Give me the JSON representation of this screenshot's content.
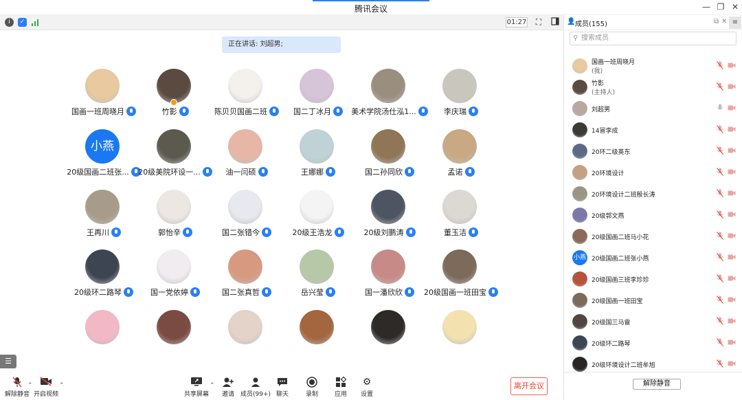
{
  "window": {
    "title": "腾讯会议"
  },
  "topbar": {
    "timer": "01:27"
  },
  "main": {
    "speaking_label": "正在讲话: ",
    "speaking_name": "刘超男;",
    "participants": [
      {
        "name": "国画一班周晓月",
        "avatar": "photo",
        "color": "#e8c9a0"
      },
      {
        "name": "竹影",
        "avatar": "photo",
        "color": "#5b4a3f",
        "host": true
      },
      {
        "name": "陈贝贝国画二班",
        "avatar": "photo",
        "color": "#f4f0ec"
      },
      {
        "name": "国二丁冰月",
        "avatar": "photo",
        "color": "#d6c4d8"
      },
      {
        "name": "美术学院汤仕泓1...",
        "avatar": "photo",
        "color": "#9a8f7f"
      },
      {
        "name": "李庆瑞",
        "avatar": "photo",
        "color": "#c9c7bd"
      },
      {
        "name": "20级国画二班张...",
        "avatar": "text",
        "text": "小燕",
        "color": "#1a78f2"
      },
      {
        "name": "20级美院环设一...",
        "avatar": "photo",
        "color": "#5c5a4f"
      },
      {
        "name": "油一闫硕",
        "avatar": "photo",
        "color": "#e6b7a6"
      },
      {
        "name": "王娜娜",
        "avatar": "photo",
        "color": "#bfd3d6"
      },
      {
        "name": "国二孙同欣",
        "avatar": "photo",
        "color": "#8f7657"
      },
      {
        "name": "孟诺",
        "avatar": "photo",
        "color": "#c9a983"
      },
      {
        "name": "王再川",
        "avatar": "photo",
        "color": "#a79c89"
      },
      {
        "name": "郭怡辛",
        "avatar": "photo",
        "color": "#ece7e2"
      },
      {
        "name": "国二张错今",
        "avatar": "photo",
        "color": "#e7e9ef"
      },
      {
        "name": "20级王浩龙",
        "avatar": "photo",
        "color": "#f4f4f4"
      },
      {
        "name": "20级刘鹏涛",
        "avatar": "photo",
        "color": "#4c5561"
      },
      {
        "name": "董玉洁",
        "avatar": "photo",
        "color": "#dcd8d2"
      },
      {
        "name": "20级环二路琴",
        "avatar": "photo",
        "color": "#3d4552"
      },
      {
        "name": "国一党依婷",
        "avatar": "photo",
        "color": "#f1ecef"
      },
      {
        "name": "国二张真哲",
        "avatar": "photo",
        "color": "#d79a80"
      },
      {
        "name": "岳兴莹",
        "avatar": "photo",
        "color": "#b7c8a8"
      },
      {
        "name": "国一潘欣欣",
        "avatar": "photo",
        "color": "#c88a86"
      },
      {
        "name": "20级国画一班田宝",
        "avatar": "photo",
        "color": "#7c6a5a"
      },
      {
        "name": "",
        "avatar": "photo",
        "color": "#f2b8c6"
      },
      {
        "name": "",
        "avatar": "photo",
        "color": "#7a4b42"
      },
      {
        "name": "",
        "avatar": "photo",
        "color": "#e3d3c8"
      },
      {
        "name": "",
        "avatar": "photo",
        "color": "#a3663f"
      },
      {
        "name": "",
        "avatar": "photo",
        "color": "#2e2a28"
      },
      {
        "name": "",
        "avatar": "photo",
        "color": "#f3e1b0"
      }
    ]
  },
  "bottombar": {
    "unmute": "解除静音",
    "start_video": "开启视频",
    "share_screen": "共享屏幕",
    "invite": "邀请",
    "members": "成员(99+)",
    "chat": "聊天",
    "record": "录制",
    "apps": "应用",
    "settings": "设置",
    "leave": "离开会议"
  },
  "panel": {
    "title": "成员(155)",
    "search_placeholder": "搜索成员",
    "unmute_all": "解除静音",
    "members": [
      {
        "name": "国画一班周晓月",
        "sub": "(我)",
        "color": "#e8c9a0",
        "mic": "muted"
      },
      {
        "name": "竹影",
        "sub": "(主持人)",
        "color": "#5b4a3f",
        "mic": "muted"
      },
      {
        "name": "刘超男",
        "sub": "",
        "color": "#b8a8a0",
        "mic": "on"
      },
      {
        "name": "14冒李成",
        "sub": "",
        "color": "#3d3a36",
        "mic": "muted"
      },
      {
        "name": "20环二级英东",
        "sub": "",
        "color": "#5d6a86",
        "mic": "muted"
      },
      {
        "name": "20环境设计",
        "sub": "",
        "color": "#c4a184",
        "mic": "muted"
      },
      {
        "name": "20环境设计二班殷长涛",
        "sub": "",
        "color": "#9b9585",
        "mic": "muted"
      },
      {
        "name": "20级郭文燕",
        "sub": "",
        "color": "#7b78a8",
        "mic": "muted"
      },
      {
        "name": "20级国画二班马小花",
        "sub": "",
        "color": "#8a6a58",
        "mic": "muted"
      },
      {
        "name": "20级国画二班张小燕",
        "sub": "",
        "color": "#1a78f2",
        "text": "小燕",
        "mic": "muted"
      },
      {
        "name": "20级国画三班李珍珍",
        "sub": "",
        "color": "#b5533c",
        "mic": "muted"
      },
      {
        "name": "20级国画一班田宝",
        "sub": "",
        "color": "#7c6a5a",
        "mic": "muted"
      },
      {
        "name": "20级国三马雷",
        "sub": "",
        "color": "#4f4740",
        "mic": "muted"
      },
      {
        "name": "20级环二路琴",
        "sub": "",
        "color": "#3d4552",
        "mic": "muted"
      },
      {
        "name": "20级环境设计二班牟旭",
        "sub": "",
        "color": "#2a2624",
        "mic": "muted"
      }
    ]
  }
}
